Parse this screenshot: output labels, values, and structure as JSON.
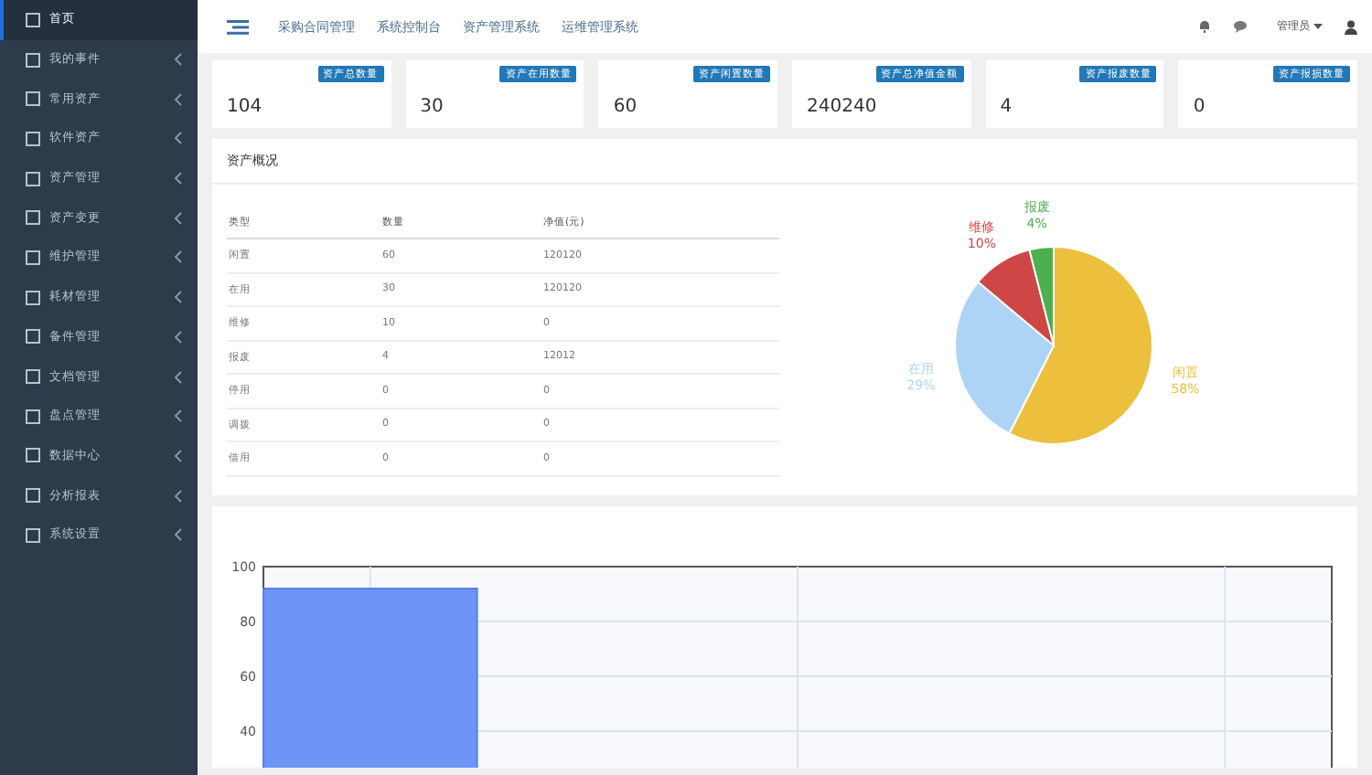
{
  "sidebar": {
    "items": [
      {
        "label": "首页",
        "selected": true,
        "has_submenu": false
      },
      {
        "label": "我的事件",
        "selected": false,
        "has_submenu": true
      },
      {
        "label": "常用资产",
        "selected": false,
        "has_submenu": true
      },
      {
        "label": "软件资产",
        "selected": false,
        "has_submenu": true
      },
      {
        "label": "资产管理",
        "selected": false,
        "has_submenu": true
      },
      {
        "label": "资产变更",
        "selected": false,
        "has_submenu": true
      },
      {
        "label": "维护管理",
        "selected": false,
        "has_submenu": true
      },
      {
        "label": "耗材管理",
        "selected": false,
        "has_submenu": true
      },
      {
        "label": "备件管理",
        "selected": false,
        "has_submenu": true
      },
      {
        "label": "文档管理",
        "selected": false,
        "has_submenu": true
      },
      {
        "label": "盘点管理",
        "selected": false,
        "has_submenu": true
      },
      {
        "label": "数据中心",
        "selected": false,
        "has_submenu": true
      },
      {
        "label": "分析报表",
        "selected": false,
        "has_submenu": true
      },
      {
        "label": "系统设置",
        "selected": false,
        "has_submenu": true
      }
    ]
  },
  "top_nav": {
    "links": [
      "采购合同管理",
      "系统控制台",
      "资产管理系统",
      "运维管理系统"
    ],
    "user": "管理员"
  },
  "stats": [
    {
      "label": "资产总数量",
      "value": "104"
    },
    {
      "label": "资产在用数量",
      "value": "30"
    },
    {
      "label": "资产闲置数量",
      "value": "60"
    },
    {
      "label": "资产总净值金额",
      "value": "240240"
    },
    {
      "label": "资产报废数量",
      "value": "4"
    },
    {
      "label": "资产报损数量",
      "value": "0"
    }
  ],
  "overview": {
    "title": "资产概况",
    "table": {
      "columns": [
        "类型",
        "数量",
        "净值(元)"
      ],
      "rows": [
        [
          "闲置",
          "60",
          "120120"
        ],
        [
          "在用",
          "30",
          "120120"
        ],
        [
          "维修",
          "10",
          "0"
        ],
        [
          "报废",
          "4",
          "12012"
        ],
        [
          "停用",
          "0",
          "0"
        ],
        [
          "调拨",
          "0",
          "0"
        ],
        [
          "借用",
          "0",
          "0"
        ]
      ]
    },
    "chart_data": {
      "type": "pie",
      "categories": [
        "闲置",
        "在用",
        "维修",
        "报废"
      ],
      "values": [
        58,
        29,
        10,
        4
      ],
      "colors": [
        "#ecbf3c",
        "#aed4f5",
        "#cf4646",
        "#4caf50"
      ],
      "value_labels": [
        "58%",
        "29%",
        "10%",
        "4%"
      ]
    }
  },
  "bar_panel": {
    "chart_data": {
      "type": "bar",
      "series": [
        {
          "color": "#6f94f7",
          "values": [
            92
          ]
        }
      ],
      "ylim": [
        0,
        100
      ],
      "yticks": [
        40,
        60,
        80,
        100
      ],
      "grid": true
    }
  }
}
